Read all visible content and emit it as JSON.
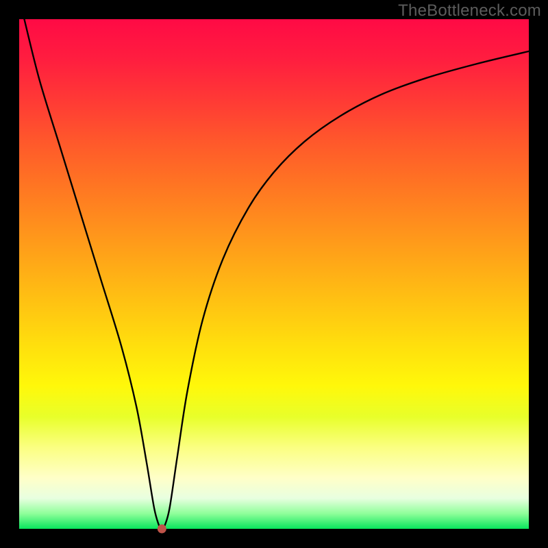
{
  "watermark": "TheBottleneck.com",
  "chart_data": {
    "type": "line",
    "title": "",
    "xlabel": "",
    "ylabel": "",
    "xlim": [
      0,
      100
    ],
    "ylim": [
      0,
      100
    ],
    "series": [
      {
        "name": "curve",
        "x": [
          1,
          4,
          8,
          12,
          16,
          20,
          23,
          25,
          26.5,
          27.5,
          28,
          28.5,
          29.5,
          31,
          33,
          36,
          40,
          45,
          50,
          56,
          63,
          71,
          80,
          90,
          100
        ],
        "values": [
          100,
          88,
          75,
          62,
          49,
          36,
          24,
          13,
          4,
          0.5,
          0,
          0.5,
          4,
          14,
          27,
          41,
          53,
          63,
          70,
          76,
          81,
          85.2,
          88.5,
          91.3,
          93.7
        ]
      }
    ],
    "marker": {
      "x": 28,
      "y": 0
    },
    "colors": {
      "curve": "#000000",
      "marker": "#c0544a",
      "frame": "#000000",
      "gradient_top": "#ff0a45",
      "gradient_bottom": "#08e65c"
    }
  }
}
